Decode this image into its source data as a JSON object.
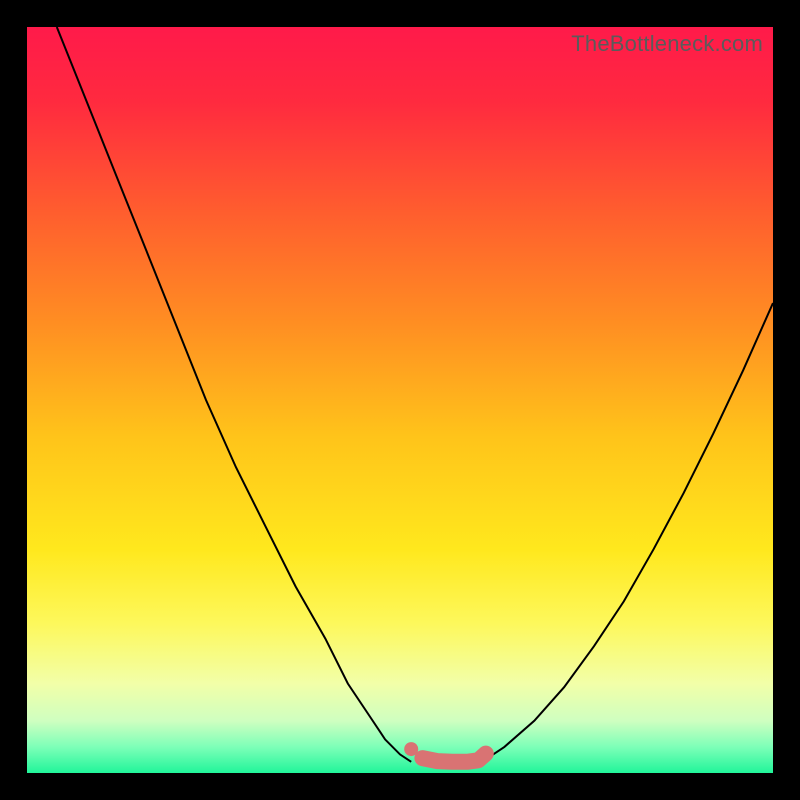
{
  "watermark": "TheBottleneck.com",
  "colors": {
    "gradient_stops": [
      {
        "offset": 0.0,
        "color": "#ff1a4a"
      },
      {
        "offset": 0.1,
        "color": "#ff2a3f"
      },
      {
        "offset": 0.25,
        "color": "#ff5e2e"
      },
      {
        "offset": 0.4,
        "color": "#ff8f22"
      },
      {
        "offset": 0.55,
        "color": "#ffc41a"
      },
      {
        "offset": 0.7,
        "color": "#ffe81d"
      },
      {
        "offset": 0.8,
        "color": "#fdf85c"
      },
      {
        "offset": 0.88,
        "color": "#f2ffa8"
      },
      {
        "offset": 0.93,
        "color": "#cfffc0"
      },
      {
        "offset": 0.965,
        "color": "#7dffb8"
      },
      {
        "offset": 1.0,
        "color": "#21f59a"
      }
    ],
    "curve": "#000000",
    "marker": "#d97373",
    "frame": "#000000"
  },
  "chart_data": {
    "type": "line",
    "title": "",
    "xlabel": "",
    "ylabel": "",
    "xlim": [
      0,
      100
    ],
    "ylim": [
      0,
      100
    ],
    "legend": false,
    "grid": false,
    "series": [
      {
        "name": "left-curve",
        "x": [
          4,
          8,
          12,
          16,
          20,
          24,
          28,
          32,
          36,
          40,
          43,
          46,
          48,
          50,
          51.5
        ],
        "y": [
          100,
          90,
          80,
          70,
          60,
          50,
          41,
          33,
          25,
          18,
          12,
          7.5,
          4.5,
          2.5,
          1.5
        ]
      },
      {
        "name": "right-curve",
        "x": [
          61,
          64,
          68,
          72,
          76,
          80,
          84,
          88,
          92,
          96,
          100
        ],
        "y": [
          1.5,
          3.5,
          7,
          11.5,
          17,
          23,
          30,
          37.5,
          45.5,
          54,
          63
        ]
      }
    ],
    "markers": {
      "name": "bottom-band",
      "points": [
        {
          "x": 51.5,
          "y": 3.2,
          "kind": "dot"
        },
        {
          "x": 53.0,
          "y": 2.0,
          "kind": "thick"
        },
        {
          "x": 55.0,
          "y": 1.6,
          "kind": "thick"
        },
        {
          "x": 57.0,
          "y": 1.5,
          "kind": "thick"
        },
        {
          "x": 59.0,
          "y": 1.5,
          "kind": "thick"
        },
        {
          "x": 60.5,
          "y": 1.7,
          "kind": "thick"
        },
        {
          "x": 61.5,
          "y": 2.6,
          "kind": "thick"
        }
      ]
    }
  }
}
